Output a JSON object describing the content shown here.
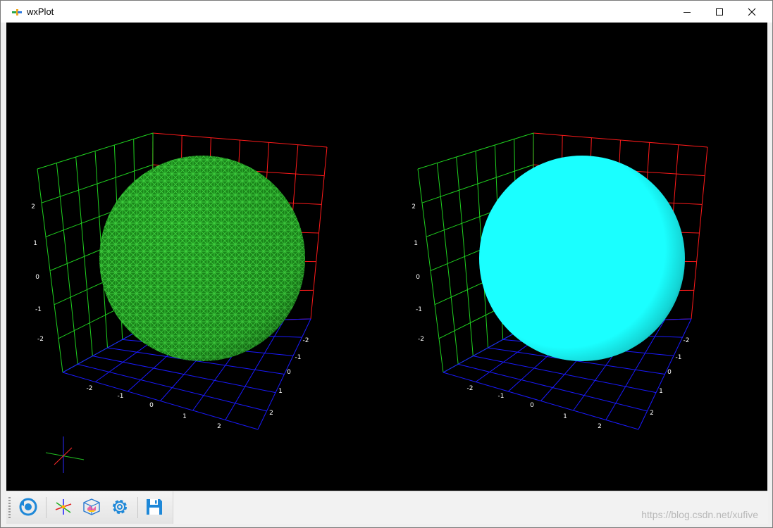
{
  "window": {
    "title": "wxPlot",
    "buttons": [
      "minimize",
      "maximize",
      "close"
    ]
  },
  "plots": [
    {
      "render_mode": "wireframe",
      "sphere_color": "#22b522",
      "axis_ticks": {
        "z": [
          "2",
          "1",
          "0",
          "-1",
          "-2"
        ],
        "x": [
          "-2",
          "-1",
          "0",
          "1",
          "2"
        ],
        "y": [
          "-2",
          "-1",
          "0",
          "1",
          "2"
        ]
      }
    },
    {
      "render_mode": "surface",
      "sphere_color": "#1affff",
      "axis_ticks": {
        "z": [
          "2",
          "1",
          "0",
          "-1",
          "-2"
        ],
        "x": [
          "-2",
          "-1",
          "0",
          "1",
          "2"
        ],
        "y": [
          "-2",
          "-1",
          "0",
          "1",
          "2"
        ]
      }
    }
  ],
  "grid_colors": {
    "x_wall": "#ff1a1a",
    "y_wall": "#1fd11f",
    "floor": "#1a1aff"
  },
  "toolbar": {
    "tools": [
      {
        "name": "rotate-view-button",
        "icon": "rotate-icon"
      },
      {
        "name": "axes-button",
        "icon": "axes-icon"
      },
      {
        "name": "box-view-button",
        "icon": "cube-icon"
      },
      {
        "name": "settings-button",
        "icon": "gear-icon"
      },
      {
        "name": "save-button",
        "icon": "save-icon"
      }
    ]
  },
  "watermark": "https://blog.csdn.net/xufive"
}
